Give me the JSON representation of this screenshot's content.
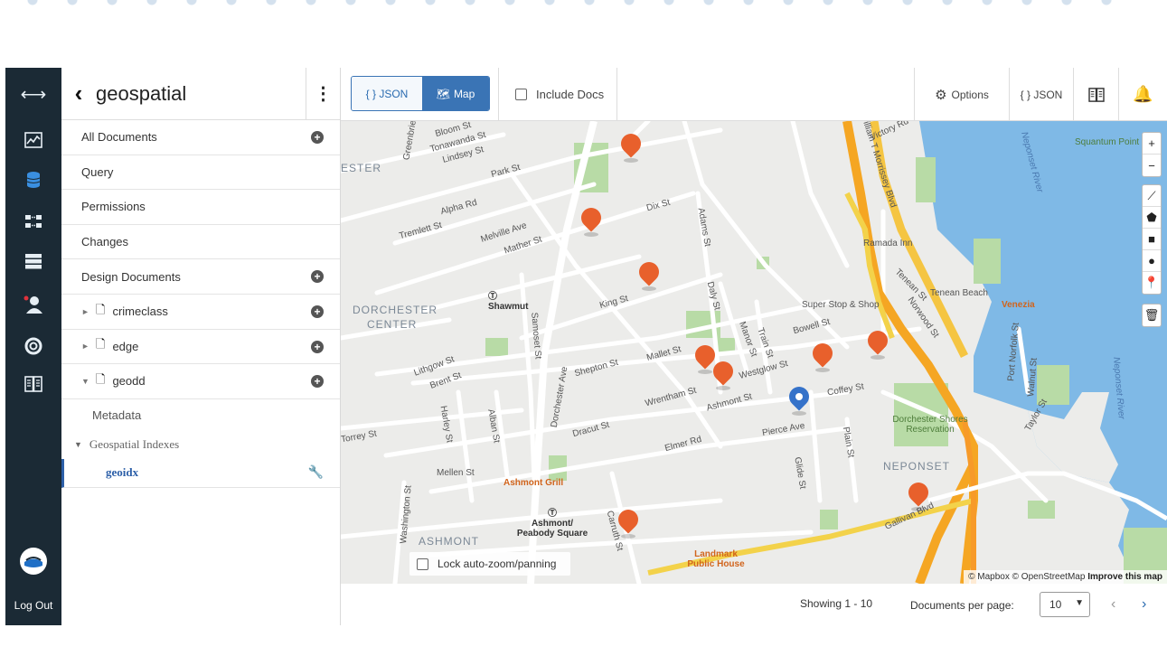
{
  "rail": {
    "logout_label": "Log Out"
  },
  "side": {
    "db_name": "geospatial",
    "items": [
      {
        "label": "All Documents"
      },
      {
        "label": "Query"
      },
      {
        "label": "Permissions"
      },
      {
        "label": "Changes"
      },
      {
        "label": "Design Documents"
      },
      {
        "label": "crimeclass"
      },
      {
        "label": "edge"
      },
      {
        "label": "geodd"
      }
    ],
    "metadata_label": "Metadata",
    "geo_indexes_label": "Geospatial Indexes",
    "geoidx_label": "geoidx"
  },
  "toolbar": {
    "json_tab": "{ } JSON",
    "map_tab": "Map",
    "include_docs": "Include Docs",
    "options": "Options",
    "json_btn": "{ } JSON"
  },
  "map": {
    "area_labels": [
      "DORCHESTER",
      "CENTER",
      "ASHMONT",
      "NEPONSET",
      "ESTER"
    ],
    "streets": [
      "Tonawanda St",
      "Lindsey St",
      "Park St",
      "Alpha Rd",
      "Tremlett St",
      "Melville Ave",
      "Mather St",
      "Dix St",
      "Adams St",
      "King St",
      "Daly St",
      "Samoset St",
      "Lithgow St",
      "Brent St",
      "Shepton St",
      "Mallet St",
      "Manor St",
      "Train St",
      "Westglow St",
      "Bowell St",
      "Wrentham St",
      "Ashmont St",
      "Coffey St",
      "Dracut St",
      "Pierce Ave",
      "Harley St",
      "Alban St",
      "Elmer Rd",
      "Mellen St",
      "Glide St",
      "Plain St",
      "Torrey St",
      "Gallivan Blvd",
      "Carruth St",
      "Dorchester Ave",
      "Washington St",
      "Norwood St",
      "Tenean St",
      "Port Norfolk St",
      "Walnut St",
      "Taylor St",
      "William T Morrissey Blvd",
      "Victory Rd",
      "Greenbrier St",
      "Bloom St"
    ],
    "pois": [
      "Shawmut",
      "Super Stop & Shop",
      "Ramada Inn",
      "Tenean Beach",
      "Venezia",
      "Dorchester Shores Reservation",
      "Ashmont/ Peabody Square",
      "Ashmont Grill",
      "Landmark Public House",
      "Squantum Point Park"
    ],
    "water": [
      "Neponset River",
      "Neponset River"
    ],
    "lock_label": "Lock auto-zoom/panning",
    "attrib_mapbox": "© Mapbox",
    "attrib_osm": "© OpenStreetMap",
    "attrib_improve": "Improve this map"
  },
  "footer": {
    "showing": "Showing 1 - 10",
    "per_page_label": "Documents per page:",
    "per_page_value": "10"
  }
}
